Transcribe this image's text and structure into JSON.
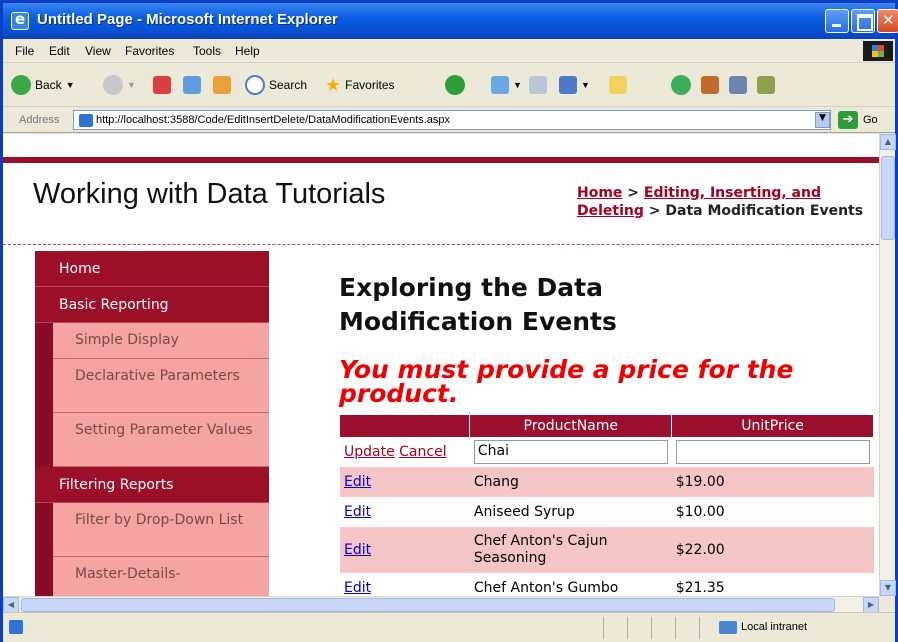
{
  "window": {
    "title": "Untitled Page - Microsoft Internet Explorer"
  },
  "menu": [
    "File",
    "Edit",
    "View",
    "Favorites",
    "Tools",
    "Help"
  ],
  "toolbar": {
    "back_label": "Back",
    "search_label": "Search",
    "favorites_label": "Favorites"
  },
  "address": {
    "label": "Address",
    "url": "http://localhost:3588/Code/EditInsertDelete/DataModificationEvents.aspx",
    "go_label": "Go"
  },
  "site": {
    "title": "Working with Data Tutorials"
  },
  "breadcrumb": {
    "home": "Home",
    "sep1": " > ",
    "section": "Editing, Inserting, and Deleting",
    "sep2": " > ",
    "current": "Data Modification Events"
  },
  "sidebar": {
    "home": "Home",
    "basic_reporting": "Basic Reporting",
    "simple_display": "Simple Display",
    "declarative_parameters": "Declarative Parameters",
    "setting_parameter_values": "Setting Parameter Values",
    "filtering_reports": "Filtering Reports",
    "filter_by_dropdown": "Filter by Drop-Down List",
    "master_details": "Master-Details-"
  },
  "page": {
    "heading": "Exploring the Data Modification Events",
    "error_message": "You must provide a price for the product."
  },
  "grid": {
    "headers": [
      "",
      "ProductName",
      "UnitPrice"
    ],
    "edit_row": {
      "update_label": "Update",
      "cancel_label": "Cancel",
      "product_value": "Chai",
      "price_value": ""
    },
    "rows": [
      {
        "action": "Edit",
        "product": "Chang",
        "price": "$19.00"
      },
      {
        "action": "Edit",
        "product": "Aniseed Syrup",
        "price": "$10.00"
      },
      {
        "action": "Edit",
        "product": "Chef Anton's Cajun Seasoning",
        "price": "$22.00"
      },
      {
        "action": "Edit",
        "product": "Chef Anton's Gumbo",
        "price": "$21.35"
      }
    ]
  },
  "status": {
    "zone": "Local intranet"
  }
}
